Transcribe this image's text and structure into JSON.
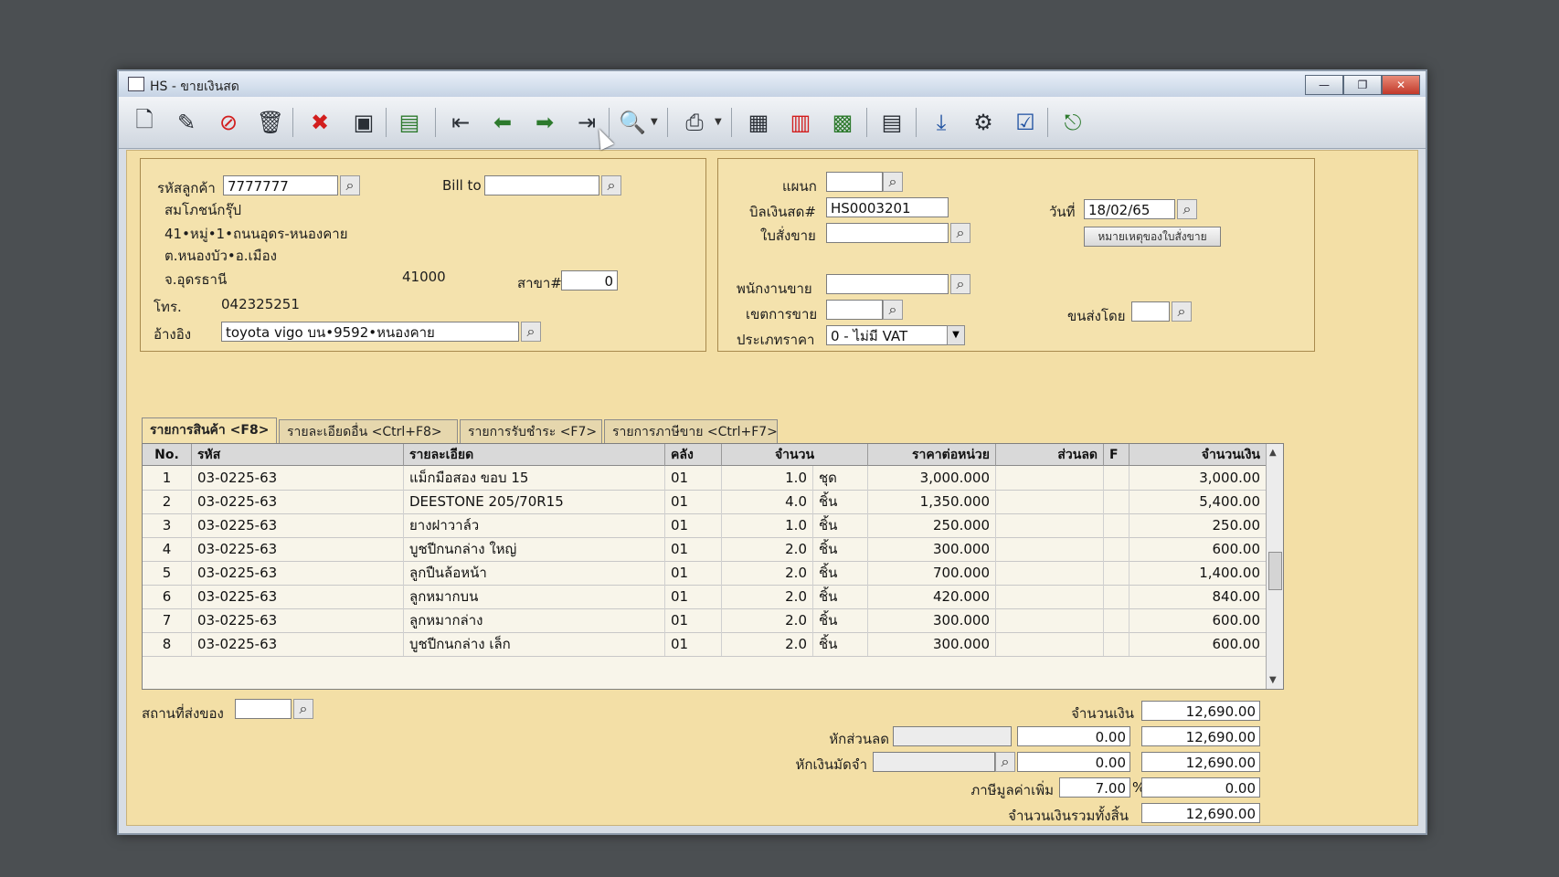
{
  "window": {
    "title": "HS - ขายเงินสด",
    "minimize": "—",
    "maximize": "❐",
    "close": "✕"
  },
  "toolbar": {
    "icons": [
      "new-doc-icon",
      "edit-icon",
      "cancel-doc-icon",
      "delete-icon",
      "stop-icon",
      "save-icon",
      "search-records-icon",
      "first-icon",
      "prev-icon",
      "next-icon",
      "last-icon",
      "preview-icon",
      "print-icon",
      "note-icon",
      "form-icon",
      "sd-icon",
      "report-icon",
      "ok-down-icon",
      "tools-icon",
      "ok-icon",
      "exit-icon"
    ]
  },
  "customer": {
    "code_label": "รหัสลูกค้า",
    "code": "7777777",
    "name": "สมโภชน์กรุ๊ป",
    "addr1": "41•หมู่•1•ถนนอุดร-หนองคาย",
    "addr2": "ต.หนองบัว•อ.เมือง",
    "addr3": "จ.อุดรธานี",
    "zip": "41000",
    "phone_label": "โทร.",
    "phone": "042325251",
    "ref_label": "อ้างอิง",
    "ref": "toyota vigo บน•9592•หนองคาย",
    "billto_label": "Bill to",
    "billto": "",
    "branch_label": "สาขา#",
    "branch": "0"
  },
  "doc": {
    "dept_label": "แผนก",
    "dept": "",
    "bill_label": "บิลเงินสด#",
    "bill": "HS0003201",
    "date_label": "วันที่",
    "date": "18/02/65",
    "so_label": "ใบสั่งขาย",
    "so": "",
    "so_note_btn": "หมายเหตุของใบสั่งขาย",
    "sales_label": "พนักงานขาย",
    "sales": "",
    "area_label": "เขตการขาย",
    "area": "",
    "ship_label": "ขนส่งโดย",
    "ship": "",
    "pricetype_label": "ประเภทราคา",
    "pricetype": "0 - ไม่มี VAT"
  },
  "tabs": [
    "รายการสินค้า <F8>",
    "รายละเอียดอื่น <Ctrl+F8>",
    "รายการรับชำระ <F7>",
    "รายการภาษีขาย <Ctrl+F7>"
  ],
  "grid": {
    "headers": {
      "no": "No.",
      "code": "รหัส",
      "desc": "รายละเอียด",
      "wh": "คลัง",
      "qty": "จำนวน",
      "price": "ราคาต่อหน่วย",
      "disc": "ส่วนลด",
      "f": "F",
      "amount": "จำนวนเงิน"
    },
    "rows": [
      {
        "no": "1",
        "code": "03-0225-63",
        "desc": "แม็กมือสอง ขอบ 15",
        "wh": "01",
        "qty": "1.0",
        "unit": "ชุด",
        "price": "3,000.000",
        "disc": "",
        "amount": "3,000.00"
      },
      {
        "no": "2",
        "code": "03-0225-63",
        "desc": "DEESTONE 205/70R15",
        "wh": "01",
        "qty": "4.0",
        "unit": "ชิ้น",
        "price": "1,350.000",
        "disc": "",
        "amount": "5,400.00"
      },
      {
        "no": "3",
        "code": "03-0225-63",
        "desc": "ยางฝาวาล์ว",
        "wh": "01",
        "qty": "1.0",
        "unit": "ชิ้น",
        "price": "250.000",
        "disc": "",
        "amount": "250.00"
      },
      {
        "no": "4",
        "code": "03-0225-63",
        "desc": "บูชปีกนกล่าง ใหญ่",
        "wh": "01",
        "qty": "2.0",
        "unit": "ชิ้น",
        "price": "300.000",
        "disc": "",
        "amount": "600.00"
      },
      {
        "no": "5",
        "code": "03-0225-63",
        "desc": "ลูกปืนล้อหน้า",
        "wh": "01",
        "qty": "2.0",
        "unit": "ชิ้น",
        "price": "700.000",
        "disc": "",
        "amount": "1,400.00"
      },
      {
        "no": "6",
        "code": "03-0225-63",
        "desc": "ลูกหมากบน",
        "wh": "01",
        "qty": "2.0",
        "unit": "ชิ้น",
        "price": "420.000",
        "disc": "",
        "amount": "840.00"
      },
      {
        "no": "7",
        "code": "03-0225-63",
        "desc": "ลูกหมากล่าง",
        "wh": "01",
        "qty": "2.0",
        "unit": "ชิ้น",
        "price": "300.000",
        "disc": "",
        "amount": "600.00"
      },
      {
        "no": "8",
        "code": "03-0225-63",
        "desc": "บูชปีกนกล่าง เล็ก",
        "wh": "01",
        "qty": "2.0",
        "unit": "ชิ้น",
        "price": "300.000",
        "disc": "",
        "amount": "600.00"
      }
    ]
  },
  "footer": {
    "shipto_label": "สถานที่ส่งของ",
    "shipto": "",
    "amount_label": "จำนวนเงิน",
    "amount": "12,690.00",
    "discount_label": "หักส่วนลด",
    "discount_text": "",
    "discount_value": "0.00",
    "discount_net": "12,690.00",
    "deposit_label": "หักเงินมัดจำ",
    "deposit_text": "",
    "deposit_value": "0.00",
    "deposit_net": "12,690.00",
    "vat_label": "ภาษีมูลค่าเพิ่ม",
    "vat_rate": "7.00",
    "vat_pct": "%",
    "vat_amount": "0.00",
    "total_label": "จำนวนเงินรวมทั้งสิ้น",
    "total": "12,690.00"
  }
}
